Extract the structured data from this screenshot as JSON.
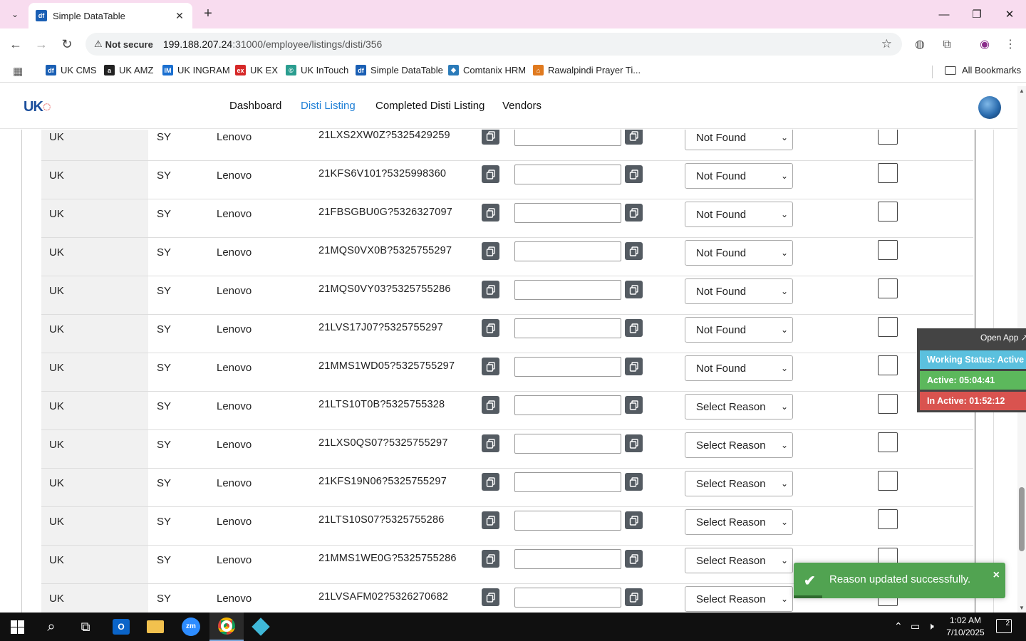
{
  "browser": {
    "tab_title": "Simple DataTable",
    "tab_favicon": "df",
    "security_label": "Not secure",
    "url_host": "199.188.207.24",
    "url_path": ":31000/employee/listings/disti/356",
    "bookmarks": [
      {
        "label": "UK CMS",
        "icon": "df",
        "color": "#1a5fb4"
      },
      {
        "label": "UK AMZ",
        "icon": "a",
        "color": "#222222"
      },
      {
        "label": "UK INGRAM",
        "icon": "IM",
        "color": "#1a6fd0"
      },
      {
        "label": "UK EX",
        "icon": "ex",
        "color": "#d62828"
      },
      {
        "label": "UK InTouch",
        "icon": "©",
        "color": "#2a9d8f"
      },
      {
        "label": "Simple DataTable",
        "icon": "df",
        "color": "#1a5fb4"
      },
      {
        "label": "Comtanix HRM",
        "icon": "◆",
        "color": "#2b7bb9"
      },
      {
        "label": "Rawalpindi Prayer Ti...",
        "icon": "⌂",
        "color": "#e07a1f"
      }
    ],
    "all_bookmarks": "All Bookmarks"
  },
  "site": {
    "logo": "UK",
    "nav": [
      "Dashboard",
      "Disti Listing",
      "Completed Disti Listing",
      "Vendors"
    ],
    "active_nav": "Disti Listing"
  },
  "rows": [
    {
      "region": "UK",
      "code": "SY",
      "brand": "Lenovo",
      "sku": "21LXS2XW0Z?5325429259",
      "reason": "Not Found"
    },
    {
      "region": "UK",
      "code": "SY",
      "brand": "Lenovo",
      "sku": "21KFS6V101?5325998360",
      "reason": "Not Found"
    },
    {
      "region": "UK",
      "code": "SY",
      "brand": "Lenovo",
      "sku": "21FBSGBU0G?5326327097",
      "reason": "Not Found"
    },
    {
      "region": "UK",
      "code": "SY",
      "brand": "Lenovo",
      "sku": "21MQS0VX0B?5325755297",
      "reason": "Not Found"
    },
    {
      "region": "UK",
      "code": "SY",
      "brand": "Lenovo",
      "sku": "21MQS0VY03?5325755286",
      "reason": "Not Found"
    },
    {
      "region": "UK",
      "code": "SY",
      "brand": "Lenovo",
      "sku": "21LVS17J07?5325755297",
      "reason": "Not Found"
    },
    {
      "region": "UK",
      "code": "SY",
      "brand": "Lenovo",
      "sku": "21MMS1WD05?5325755297",
      "reason": "Not Found"
    },
    {
      "region": "UK",
      "code": "SY",
      "brand": "Lenovo",
      "sku": "21LTS10T0B?5325755328",
      "reason": "Select Reason"
    },
    {
      "region": "UK",
      "code": "SY",
      "brand": "Lenovo",
      "sku": "21LXS0QS07?5325755297",
      "reason": "Select Reason"
    },
    {
      "region": "UK",
      "code": "SY",
      "brand": "Lenovo",
      "sku": "21KFS19N06?5325755297",
      "reason": "Select Reason"
    },
    {
      "region": "UK",
      "code": "SY",
      "brand": "Lenovo",
      "sku": "21LTS10S07?5325755286",
      "reason": "Select Reason"
    },
    {
      "region": "UK",
      "code": "SY",
      "brand": "Lenovo",
      "sku": "21MMS1WE0G?5325755286",
      "reason": "Select Reason"
    },
    {
      "region": "UK",
      "code": "SY",
      "brand": "Lenovo",
      "sku": "21LVSAFM02?5326270682",
      "reason": "Select Reason"
    }
  ],
  "tracker": {
    "open_app": "Open App ↗",
    "working_status": "Working Status: Active",
    "active": "Active: 05:04:41",
    "inactive": "In Active: 01:52:12"
  },
  "toast": {
    "message": "Reason updated successfully.",
    "close": "×"
  },
  "taskbar": {
    "time": "1:02 AM",
    "date": "7/10/2025",
    "notifications": "2"
  }
}
